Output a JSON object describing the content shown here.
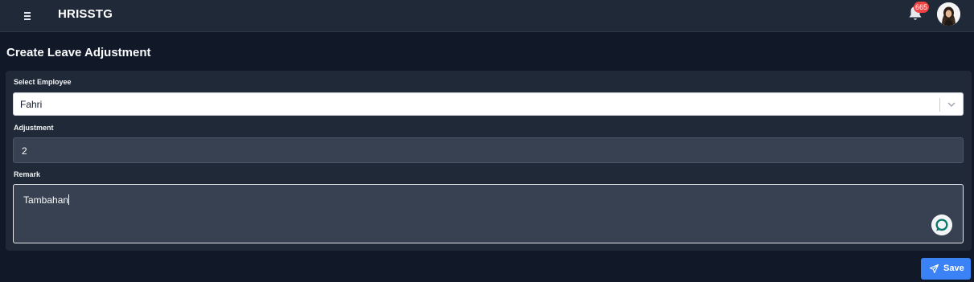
{
  "header": {
    "app_title": "HRISSTG",
    "notification_count": "665"
  },
  "page": {
    "title": "Create Leave Adjustment"
  },
  "form": {
    "employee": {
      "label": "Select Employee",
      "value": "Fahri"
    },
    "adjustment": {
      "label": "Adjustment",
      "value": "2"
    },
    "remark": {
      "label": "Remark",
      "value": "Tambahan"
    }
  },
  "actions": {
    "save_label": "Save"
  },
  "colors": {
    "background": "#111827",
    "card": "#1f2937",
    "input": "#374151",
    "accent": "#3b82f6",
    "badge": "#ef4444"
  },
  "icons": [
    "menu-icon",
    "bell-icon",
    "avatar",
    "chevron-down-icon",
    "chat-icon",
    "send-icon"
  ]
}
